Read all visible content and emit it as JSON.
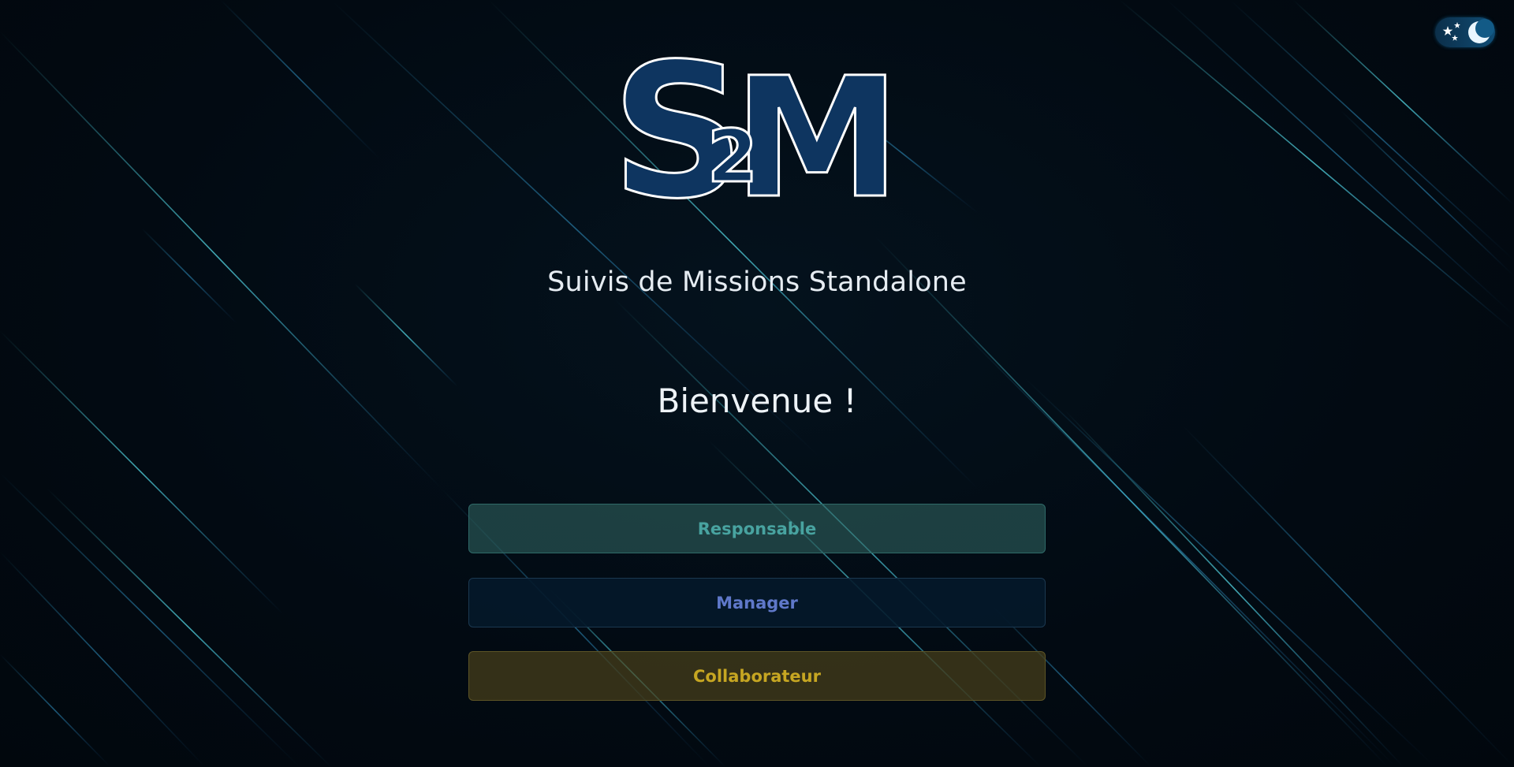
{
  "logo": {
    "text_s": "S",
    "text_2": "2",
    "text_m": "M",
    "fill_color": "#0e3560",
    "outline_color": "#ffffff"
  },
  "theme_toggle": {
    "icons": [
      "stars-icon",
      "moon-icon"
    ],
    "mode": "dark"
  },
  "subtitle": "Suivis de Missions Standalone",
  "welcome": "Bienvenue !",
  "roles": {
    "responsable": "Responsable",
    "manager": "Manager",
    "collaborateur": "Collaborateur"
  },
  "colors": {
    "background": "#020a12",
    "streak": "#3fb6c6",
    "responsable_text": "#48a3a0",
    "manager_text": "#5f78c9",
    "collaborateur_text": "#c6a622"
  }
}
